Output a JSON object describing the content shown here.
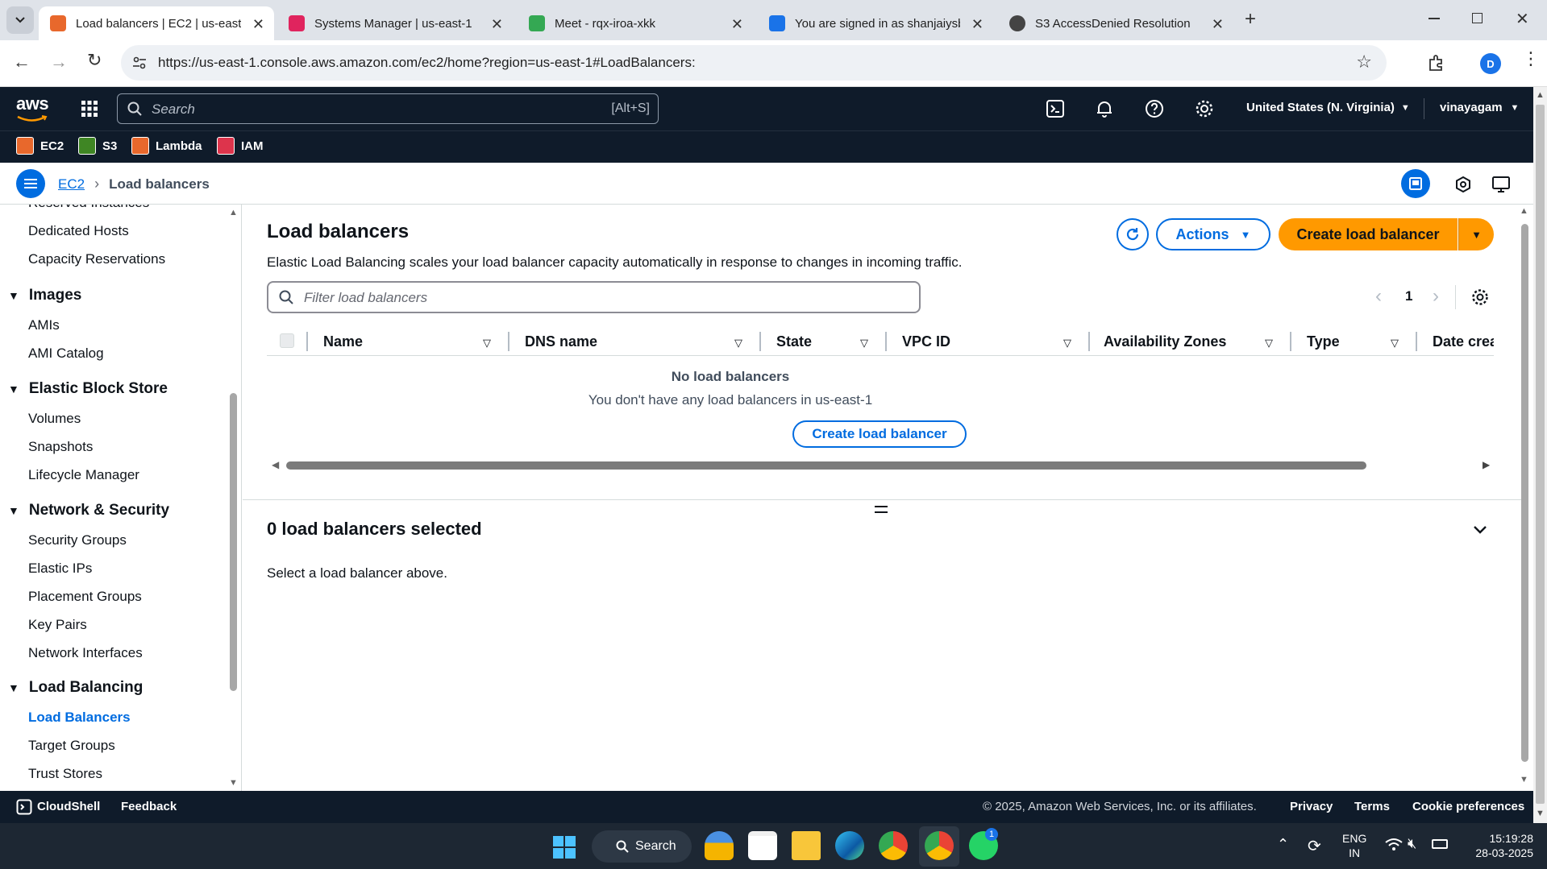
{
  "browser": {
    "tabs": [
      {
        "title": "Load balancers | EC2 | us-east-1",
        "color": "#e8682c"
      },
      {
        "title": "Systems Manager | us-east-1",
        "color": "#e0245e"
      },
      {
        "title": "Meet - rqx-iroa-xkk",
        "color": "#34a853"
      },
      {
        "title": "You are signed in as shanjaiysb",
        "color": "#1a73e8"
      },
      {
        "title": "S3 AccessDenied Resolution",
        "color": "#444444"
      }
    ],
    "url": "https://us-east-1.console.aws.amazon.com/ec2/home?region=us-east-1#LoadBalancers:",
    "profile_initial": "D"
  },
  "aws_header": {
    "logo": "aws",
    "search_placeholder": "Search",
    "search_shortcut": "[Alt+S]",
    "region": "United States (N. Virginia)",
    "user": "vinayagam",
    "favorites": [
      "EC2",
      "S3",
      "Lambda",
      "IAM"
    ]
  },
  "breadcrumb": {
    "parent": "EC2",
    "current": "Load balancers"
  },
  "sidebar": {
    "partial_top": "Reserved Instances",
    "items_top": [
      "Dedicated Hosts",
      "Capacity Reservations"
    ],
    "sections": [
      {
        "title": "Images",
        "items": [
          "AMIs",
          "AMI Catalog"
        ]
      },
      {
        "title": "Elastic Block Store",
        "items": [
          "Volumes",
          "Snapshots",
          "Lifecycle Manager"
        ]
      },
      {
        "title": "Network & Security",
        "items": [
          "Security Groups",
          "Elastic IPs",
          "Placement Groups",
          "Key Pairs",
          "Network Interfaces"
        ]
      },
      {
        "title": "Load Balancing",
        "items": [
          "Load Balancers",
          "Target Groups",
          "Trust Stores"
        ]
      }
    ]
  },
  "main": {
    "title": "Load balancers",
    "description": "Elastic Load Balancing scales your load balancer capacity automatically in response to changes in incoming traffic.",
    "actions_label": "Actions",
    "create_label": "Create load balancer",
    "filter_placeholder": "Filter load balancers",
    "page_number": "1",
    "columns": [
      "Name",
      "DNS name",
      "State",
      "VPC ID",
      "Availability Zones",
      "Type",
      "Date crea"
    ],
    "empty_title": "No load balancers",
    "empty_message": "You don't have any load balancers in us-east-1",
    "empty_create_label": "Create load balancer",
    "selected_title": "0 load balancers selected",
    "selected_message": "Select a load balancer above."
  },
  "footer": {
    "cloudshell": "CloudShell",
    "feedback": "Feedback",
    "copyright": "© 2025, Amazon Web Services, Inc. or its affiliates.",
    "privacy": "Privacy",
    "terms": "Terms",
    "cookies": "Cookie preferences"
  },
  "taskbar": {
    "search": "Search",
    "lang": "ENG",
    "region": "IN",
    "time": "15:19:28",
    "date": "28-03-2025",
    "whatsapp_badge": "1"
  },
  "colors": {
    "accent": "#006ce0",
    "primary_button": "#ff9900",
    "aws_dark": "#0f1b2a"
  }
}
